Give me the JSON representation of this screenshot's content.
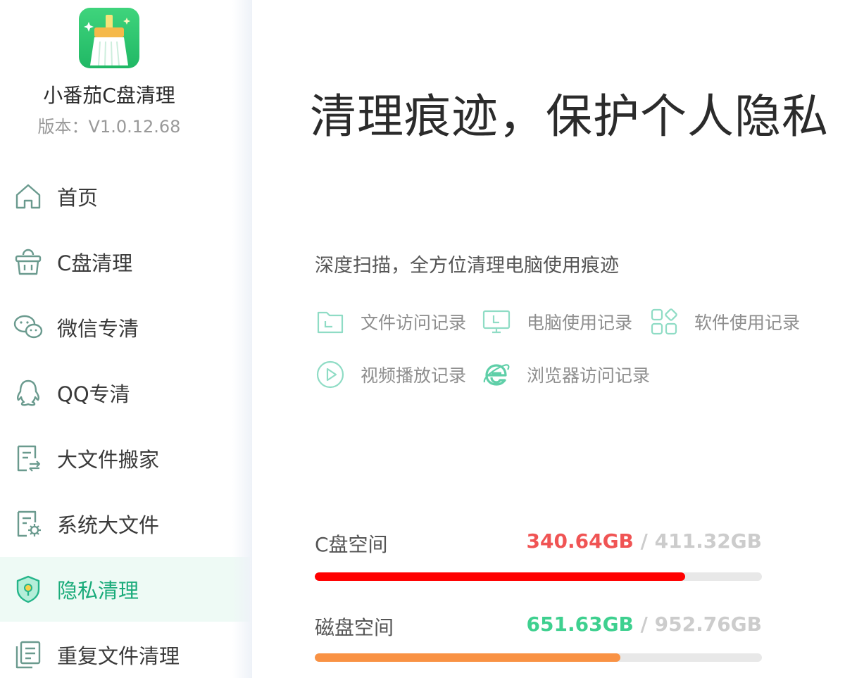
{
  "app": {
    "name": "小番茄C盘清理",
    "version": "版本：V1.0.12.68"
  },
  "sidebar": {
    "items": [
      {
        "label": "首页",
        "icon": "home-icon",
        "active": false
      },
      {
        "label": "C盘清理",
        "icon": "basket-icon",
        "active": false
      },
      {
        "label": "微信专清",
        "icon": "wechat-icon",
        "active": false
      },
      {
        "label": "QQ专清",
        "icon": "qq-icon",
        "active": false
      },
      {
        "label": "大文件搬家",
        "icon": "file-move-icon",
        "active": false
      },
      {
        "label": "系统大文件",
        "icon": "system-file-icon",
        "active": false
      },
      {
        "label": "隐私清理",
        "icon": "privacy-shield-icon",
        "active": true
      },
      {
        "label": "重复文件清理",
        "icon": "duplicate-file-icon",
        "active": false
      }
    ]
  },
  "main": {
    "title": "清理痕迹，保护个人隐私",
    "subtitle": "深度扫描，全方位清理电脑使用痕迹",
    "features": [
      {
        "label": "文件访问记录",
        "icon": "folder-icon"
      },
      {
        "label": "电脑使用记录",
        "icon": "monitor-icon"
      },
      {
        "label": "软件使用记录",
        "icon": "apps-grid-icon"
      },
      {
        "label": "视频播放记录",
        "icon": "play-icon"
      },
      {
        "label": "浏览器访问记录",
        "icon": "browser-ie-icon"
      }
    ]
  },
  "disks": [
    {
      "label": "C盘空间",
      "used": "340.64GB",
      "sep": " / ",
      "total": "411.32GB",
      "used_color": "#f05454",
      "bar_color": "#ff0000",
      "fill_fraction": 0.828
    },
    {
      "label": "磁盘空间",
      "used": "651.63GB",
      "sep": " / ",
      "total": "952.76GB",
      "used_color": "#3ed08f",
      "bar_color": "#f99244",
      "fill_fraction": 0.684
    }
  ],
  "colors": {
    "accent": "#1aab7a",
    "icon_teal": "#6fd1b4",
    "nav_icon": "#6a9a8e"
  }
}
